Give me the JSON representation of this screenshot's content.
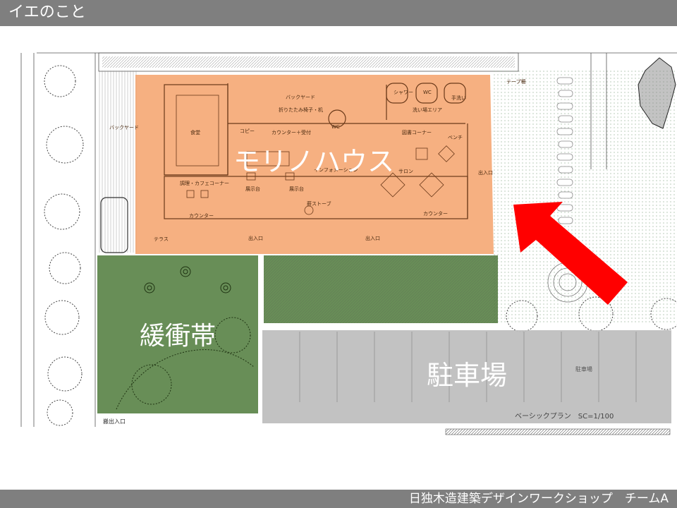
{
  "header": {
    "title": "イエのこと"
  },
  "footer": {
    "caption": "日独木造建築デザインワークショップ　チームA"
  },
  "zones": {
    "house": {
      "label": "モリノハウス",
      "color": "#f4a26b"
    },
    "buffer": {
      "label": "緩衝帯",
      "color": "#4d7a3a"
    },
    "parking": {
      "label": "駐車場",
      "color": "#bfbfbf"
    }
  },
  "plan_labels": {
    "backyard_left": "バックヤード",
    "backyard_top": "バックヤード",
    "dining": "食堂",
    "kitchen": "調理・カフェコーナー",
    "copy": "コピー",
    "counter_reception": "カウンター＋受付",
    "shower": "シャワー",
    "wc_top": "WC",
    "handwash": "手洗い",
    "washing_area": "洗い場エリア",
    "wc_center": "WC",
    "library_corner": "図書コーナー",
    "bench": "ベンチ",
    "information": "インフォメーション",
    "salon": "サロン",
    "entrance_right": "出入口",
    "wood_stove": "薪ストーブ",
    "counter_bottom": "カウンター",
    "counter_left": "カウンター",
    "terrace": "テラス",
    "entrance_bottom_1": "出入口",
    "entrance_bottom_2": "出入口",
    "display_1": "展示台",
    "display_2": "展示台",
    "folding_chairs": "折りたたみ椅子・机",
    "tape_fence": "テープ柵",
    "delivery_entrance": "搬出入口",
    "parking_small": "駐車場",
    "plan_caption": "ベーシックプラン　SC=1/100"
  },
  "arrow": {
    "color": "#ff0000"
  }
}
